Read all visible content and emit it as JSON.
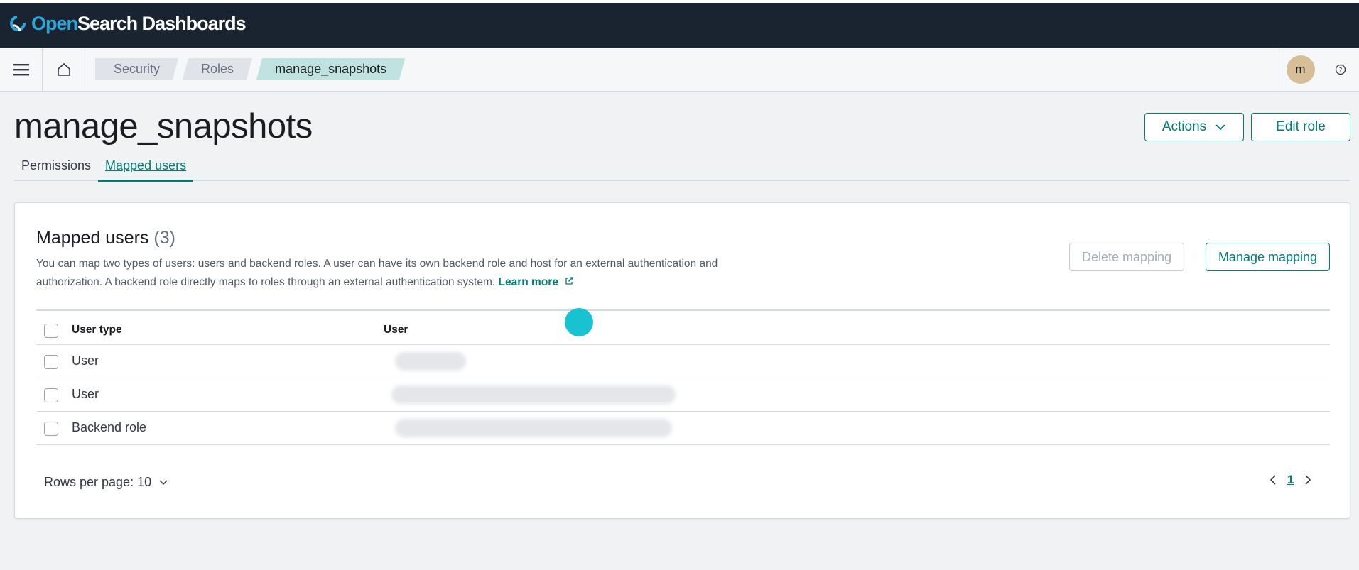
{
  "brand": {
    "open": "Open",
    "rest": "Search Dashboards",
    "accent": "#2ea6d9"
  },
  "header": {
    "breadcrumbs": [
      "Security",
      "Roles",
      "manage_snapshots"
    ],
    "avatar_initial": "m"
  },
  "page": {
    "title": "manage_snapshots",
    "actions_label": "Actions",
    "edit_role_label": "Edit role",
    "tabs": [
      "Permissions",
      "Mapped users"
    ],
    "active_tab": "Mapped users"
  },
  "panel": {
    "title": "Mapped users",
    "count": "(3)",
    "description": "You can map two types of users: users and backend roles. A user can have its own backend role and host for an external authentication and authorization. A backend role directly maps to roles through an external authentication system.",
    "learn_more": "Learn more",
    "delete_mapping_label": "Delete mapping",
    "manage_mapping_label": "Manage mapping",
    "table": {
      "columns": [
        "User type",
        "User"
      ],
      "rows": [
        {
          "type": "User",
          "user": ""
        },
        {
          "type": "User",
          "user": ""
        },
        {
          "type": "Backend role",
          "user": ""
        }
      ]
    },
    "rows_per_page": "Rows per page: 10",
    "current_page": "1"
  },
  "colors": {
    "accent": "#017d73",
    "topbar": "#1a2330",
    "active_crumb": "#bfe3e0"
  }
}
